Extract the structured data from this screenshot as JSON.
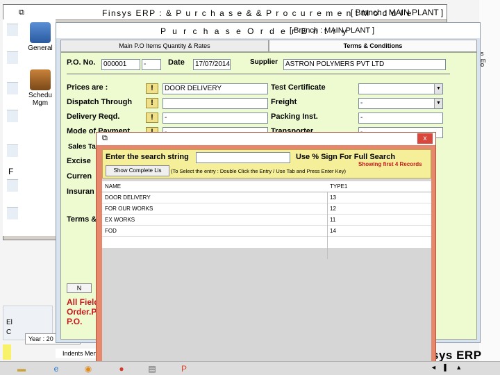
{
  "outer_window": {
    "title": "Finsys ERP  :  & P u r c h a s e   & &   P r o c u r e m e n t   M o d u l e",
    "branch": "[ Branch : MAIN PLANT ]"
  },
  "desktop_icons": [
    {
      "label": "General"
    },
    {
      "label": "Schedu\nMgm"
    }
  ],
  "lower_left": {
    "line1": "El",
    "line2": "C"
  },
  "yes_bar": "Year : 20",
  "indents_bar": "Indents Men",
  "brand": "sys ERP",
  "right_strip": {
    "line1": "s",
    "line2": "m",
    "line3": "o"
  },
  "po_window": {
    "title": "P u r c h a s e   O r d e r   E n t r y",
    "branch": "[ Branch : MAIN PLANT ]",
    "tabs": [
      {
        "label": "Main P.O Items  Quantity & Rates"
      },
      {
        "label": "Terms & Conditions"
      }
    ],
    "header": {
      "po_no_label": "P.O. No.",
      "po_no_value": "000001",
      "po_suffix": "-",
      "date_label": "Date",
      "date_value": "17/07/2014",
      "supplier_label": "Supplier",
      "supplier_value": "ASTRON POLYMERS PVT LTD"
    },
    "left_fields": [
      {
        "label": "Prices are :",
        "value": "DOOR DELIVERY"
      },
      {
        "label": "Dispatch Through",
        "value": ""
      },
      {
        "label": "Delivery Reqd.",
        "value": "-"
      },
      {
        "label": "Mode of Payment",
        "value": "-"
      }
    ],
    "right_fields": [
      {
        "label": "Test Certificate",
        "value": ""
      },
      {
        "label": "Freight",
        "value": "-"
      },
      {
        "label": "Packing Inst.",
        "value": "-"
      },
      {
        "label": "Transporter",
        "value": "-"
      }
    ],
    "partial_labels": [
      "Sales Ta",
      "Excise",
      "Curren",
      "Insuran",
      "Terms &"
    ],
    "small_button": "N",
    "red_notes": [
      "All Field",
      "Order.P",
      "P.O."
    ]
  },
  "search_dialog": {
    "search_label": "Enter the search string",
    "search_value": "",
    "hint": "Use % Sign For Full Search",
    "showing": "Showing first 4 Records",
    "show_button": "Show Complete Lis",
    "instructions": "(To Select the entry : Double Click the Entry / Use Tab and Press Enter Key)",
    "columns": [
      "NAME",
      "TYPE1"
    ],
    "rows": [
      {
        "name": "DOOR DELIVERY",
        "type1": "13"
      },
      {
        "name": "FOR OUR WORKS",
        "type1": "12"
      },
      {
        "name": "EX WORKS",
        "type1": "11"
      },
      {
        "name": "FOD",
        "type1": "14"
      }
    ],
    "close_label": "x"
  },
  "taskbar": {
    "icons": [
      "folder-icon",
      "ie-icon",
      "outlook-icon",
      "chrome-icon",
      "files-icon",
      "ppt-icon"
    ],
    "tray": "◄ ▌ ▲"
  }
}
